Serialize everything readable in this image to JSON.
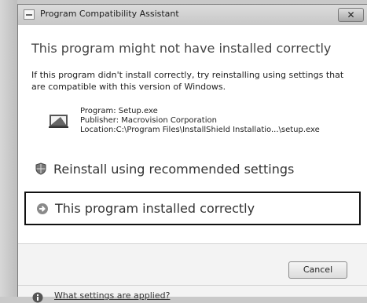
{
  "window": {
    "title": "Program Compatibility Assistant",
    "close_glyph": "✕"
  },
  "main": {
    "headline": "This program might not have installed correctly",
    "description": "If this program didn't install correctly, try reinstalling using settings that are compatible with this version of Windows.",
    "program_line": "Program: Setup.exe",
    "publisher_line": "Publisher: Macrovision Corporation",
    "location_line": "Location:C:\\Program Files\\InstallShield Installatio...\\setup.exe",
    "program_icon": "installer-icon"
  },
  "options": {
    "reinstall_label": "Reinstall using recommended settings",
    "reinstall_icon": "shield-icon",
    "installed_label": "This program installed correctly",
    "installed_icon": "arrow-right-icon"
  },
  "footer": {
    "cancel_label": "Cancel",
    "help_link": "What settings are applied?",
    "help_icon": "info-icon"
  }
}
